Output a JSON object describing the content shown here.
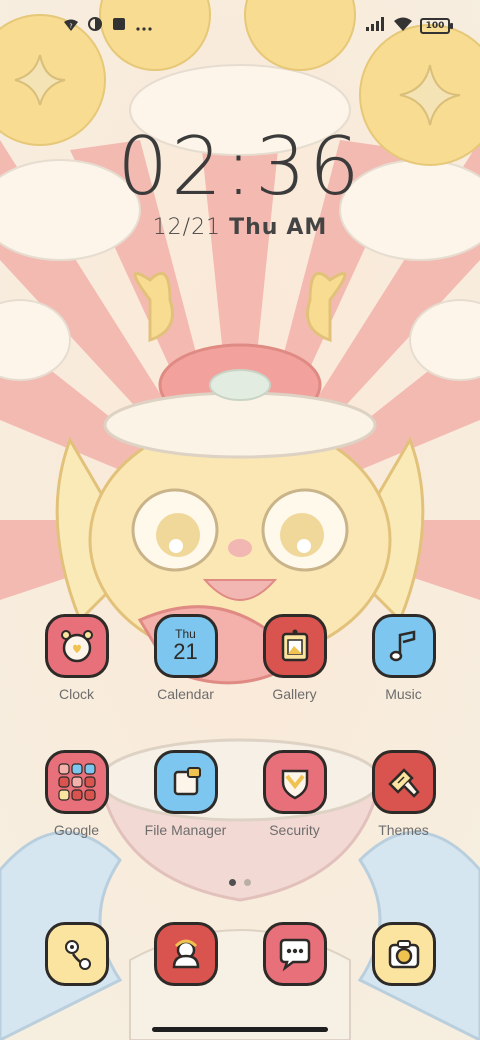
{
  "status_bar": {
    "icons_left": [
      "wifi-question-icon",
      "data-saver-icon",
      "stop-icon",
      "more-icon"
    ],
    "battery": "100"
  },
  "lockscreen": {
    "time": "02:36",
    "date": "12/21",
    "weekday": "Thu",
    "ampm": "AM"
  },
  "apps_row1": [
    {
      "label": "Clock",
      "icon": "alarm-clock-icon",
      "color": "#e8707a"
    },
    {
      "label": "Calendar",
      "icon": "calendar-icon",
      "color": "#7cc6ef",
      "day": "Thu",
      "date": "21"
    },
    {
      "label": "Gallery",
      "icon": "picture-icon",
      "color": "#d9534f"
    },
    {
      "label": "Music",
      "icon": "music-note-icon",
      "color": "#7cc6ef"
    }
  ],
  "apps_row2": [
    {
      "label": "Google",
      "icon": "google-folder-icon",
      "color": "#e8707a"
    },
    {
      "label": "File Manager",
      "icon": "file-manager-icon",
      "color": "#7cc6ef"
    },
    {
      "label": "Security",
      "icon": "shield-icon",
      "color": "#e8707a"
    },
    {
      "label": "Themes",
      "icon": "paintbrush-icon",
      "color": "#d9534f"
    }
  ],
  "dock": [
    {
      "icon": "flower-icon",
      "color": "#fbe3a0"
    },
    {
      "icon": "contacts-icon",
      "color": "#d9534f"
    },
    {
      "icon": "messages-icon",
      "color": "#e8707a"
    },
    {
      "icon": "camera-icon",
      "color": "#fbe3a0"
    }
  ],
  "page_indicator": {
    "pages": 2,
    "current": 1
  },
  "colors": {
    "background": "#f7eddc",
    "rays": "#f0a9a4",
    "gold": "#f7d98c"
  }
}
